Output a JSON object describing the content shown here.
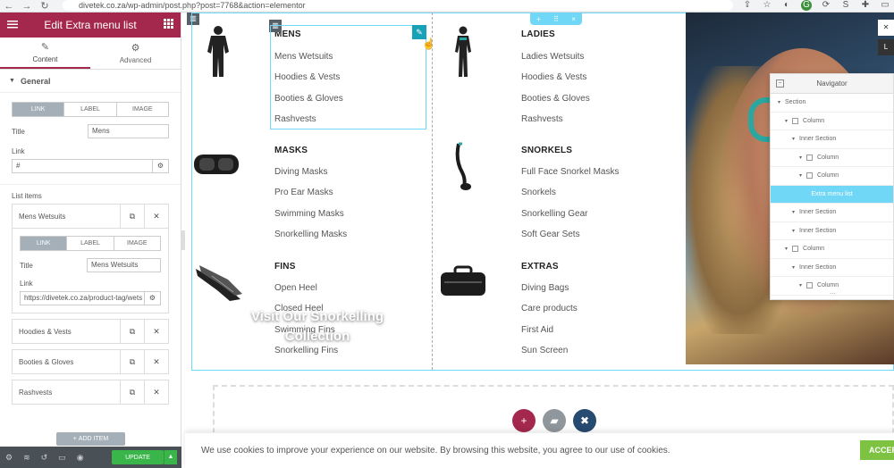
{
  "browser": {
    "url": "divetek.co.za/wp-admin/post.php?post=7768&action=elementor",
    "back_icon": "arrow-left-icon",
    "forward_icon": "arrow-right-icon",
    "reload_icon": "reload-icon"
  },
  "panel": {
    "title": "Edit Extra menu list",
    "tabs": [
      {
        "label": "Content",
        "icon": "pencil-icon",
        "active": true
      },
      {
        "label": "Advanced",
        "icon": "gear-icon",
        "active": false
      }
    ],
    "section_title": "General",
    "type_options": [
      "LINK",
      "LABEL",
      "IMAGE"
    ],
    "title_label": "Title",
    "title_value": "Mens",
    "link_label": "Link",
    "link_value": "#",
    "list_items_label": "List items",
    "items": [
      {
        "title": "Mens Wetsuits",
        "expanded": true,
        "item_title_label": "Title",
        "item_title_value": "Mens Wetsuits",
        "item_link_label": "Link",
        "item_link_value": "https://divetek.co.za/product-tag/wets"
      },
      {
        "title": "Hoodies & Vests",
        "expanded": false
      },
      {
        "title": "Booties & Gloves",
        "expanded": false
      },
      {
        "title": "Rashvests",
        "expanded": false
      }
    ],
    "add_item_label": "ADD ITEM",
    "update_label": "UPDATE"
  },
  "canvas": {
    "section_handle": {
      "add": "+",
      "move": "⠿",
      "close": "×"
    },
    "categories": [
      {
        "title": "MENS",
        "image": "wetsuit-image",
        "items": [
          "Mens Wetsuits",
          "Hoodies & Vests",
          "Booties & Gloves",
          "Rashvests"
        ]
      },
      {
        "title": "LADIES",
        "image": "wetsuit-image",
        "items": [
          "Ladies Wetsuits",
          "Hoodies & Vests",
          "Booties & Gloves",
          "Rashvests"
        ]
      },
      {
        "title": "MASKS",
        "image": "mask-image",
        "items": [
          "Diving Masks",
          "Pro Ear Masks",
          "Swimming Masks",
          "Snorkelling Masks"
        ]
      },
      {
        "title": "SNORKELS",
        "image": "snorkel-image",
        "items": [
          "Full Face Snorkel Masks",
          "Snorkels",
          "Snorkelling Gear",
          "Soft Gear Sets"
        ]
      },
      {
        "title": "FINS",
        "image": "fins-image",
        "items": [
          "Open Heel",
          "Closed Heel",
          "Swimming Fins",
          "Snorkelling Fins"
        ]
      },
      {
        "title": "EXTRAS",
        "image": "bag-image",
        "items": [
          "Diving Bags",
          "Care products",
          "First Aid",
          "Sun Screen"
        ]
      }
    ],
    "hero_text": "Visit Our Snorkelling Collection",
    "top_right_tab_label": "L"
  },
  "navigator": {
    "title": "Navigator",
    "rows": [
      {
        "label": "Section",
        "depth": 0,
        "caret": true,
        "icon": false,
        "selected": false
      },
      {
        "label": "Column",
        "depth": 1,
        "caret": true,
        "icon": true,
        "selected": false
      },
      {
        "label": "Inner Section",
        "depth": 2,
        "caret": true,
        "icon": false,
        "selected": false
      },
      {
        "label": "Column",
        "depth": 3,
        "caret": true,
        "icon": true,
        "selected": false
      },
      {
        "label": "Column",
        "depth": 3,
        "caret": true,
        "icon": true,
        "selected": false
      },
      {
        "label": "Extra menu list",
        "depth": 4,
        "caret": false,
        "icon": false,
        "selected": true
      },
      {
        "label": "Inner Section",
        "depth": 2,
        "caret": true,
        "icon": false,
        "selected": false
      },
      {
        "label": "Inner Section",
        "depth": 2,
        "caret": true,
        "icon": false,
        "selected": false
      },
      {
        "label": "Column",
        "depth": 1,
        "caret": true,
        "icon": true,
        "selected": false
      },
      {
        "label": "Inner Section",
        "depth": 2,
        "caret": true,
        "icon": false,
        "selected": false
      },
      {
        "label": "Column",
        "depth": 3,
        "caret": true,
        "icon": true,
        "selected": false
      }
    ]
  },
  "cookie": {
    "text": "We use cookies to improve your experience on our website. By browsing this website, you agree to our use of cookies.",
    "accept_label": "ACCEPT"
  },
  "colors": {
    "brand": "#a4284d",
    "accent": "#71d7f7",
    "update": "#39b54a",
    "cookie_accept": "#7ec242"
  }
}
